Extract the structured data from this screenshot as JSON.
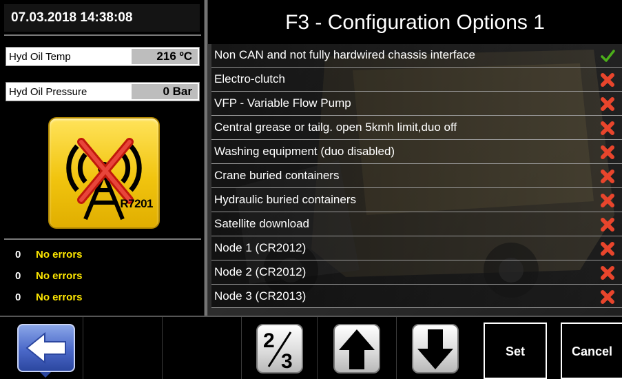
{
  "left_panel": {
    "datetime": "07.03.2018 14:38:08",
    "readings": [
      {
        "label": "Hyd Oil Temp",
        "value": "216 ºC"
      },
      {
        "label": "Hyd Oil Pressure",
        "value": "0 Bar"
      }
    ],
    "radio_status": {
      "icon": "radio-disconnected-icon",
      "code": "R7201"
    },
    "errors": [
      {
        "count": "0",
        "message": "No errors"
      },
      {
        "count": "0",
        "message": "No errors"
      },
      {
        "count": "0",
        "message": "No errors"
      }
    ]
  },
  "main": {
    "title": "F3 - Configuration Options 1",
    "options": [
      {
        "label": "Non CAN and not fully hardwired chassis interface",
        "enabled": true
      },
      {
        "label": "Electro-clutch",
        "enabled": false
      },
      {
        "label": "VFP - Variable Flow Pump",
        "enabled": false
      },
      {
        "label": "Central grease or tailg. open 5kmh limit,duo off",
        "enabled": false
      },
      {
        "label": "Washing equipment  (duo disabled)",
        "enabled": false
      },
      {
        "label": "Crane buried containers",
        "enabled": false
      },
      {
        "label": "Hydraulic buried containers",
        "enabled": false
      },
      {
        "label": "Satellite download",
        "enabled": false
      },
      {
        "label": "Node 1 (CR2012)",
        "enabled": false
      },
      {
        "label": "Node 2 (CR2012)",
        "enabled": false
      },
      {
        "label": "Node 3 (CR2013)",
        "enabled": false
      }
    ]
  },
  "bottom_bar": {
    "back_icon": "arrow-left-icon",
    "page_current": "2",
    "page_total": "3",
    "up_icon": "arrow-up-icon",
    "down_icon": "arrow-down-icon",
    "set_label": "Set",
    "cancel_label": "Cancel"
  },
  "colors": {
    "check": "#4caf1a",
    "cross": "#e8452c",
    "error_text": "#ffe800",
    "radio_yellow": "#f1c40f"
  }
}
